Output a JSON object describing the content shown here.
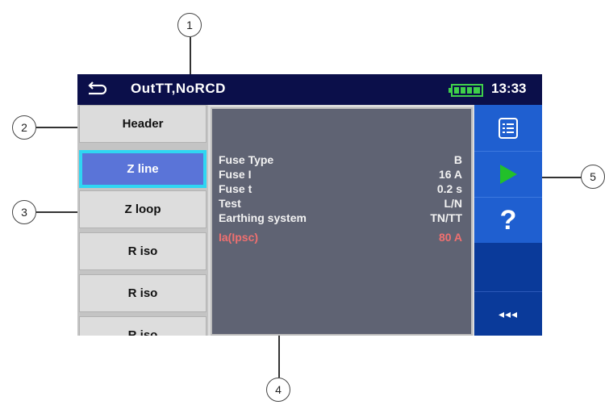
{
  "titlebar": {
    "title": "OutTT,NoRCD",
    "time": "13:33",
    "back_icon": "back-arrow-icon",
    "battery_icon": "battery-icon"
  },
  "list": {
    "items": [
      {
        "label": "Header"
      },
      {
        "label": "Z line",
        "selected": true
      },
      {
        "label": "Z loop"
      },
      {
        "label": "R iso"
      },
      {
        "label": "R iso"
      },
      {
        "label": "R iso"
      }
    ]
  },
  "parameters": [
    {
      "label": "Fuse Type",
      "value": "B"
    },
    {
      "label": "Fuse I",
      "value": "16 A"
    },
    {
      "label": "Fuse t",
      "value": "0.2 s"
    },
    {
      "label": "Test",
      "value": "L/N"
    },
    {
      "label": "Earthing system",
      "value": "TN/TT"
    }
  ],
  "result": {
    "label": "Ia(Ipsc)",
    "value": "80 A"
  },
  "toolbar": {
    "options_icon": "list-options-icon",
    "start_icon": "play-icon",
    "help_label": "?",
    "more_label": "◂◂◂"
  },
  "callouts": [
    "1",
    "2",
    "3",
    "4",
    "5"
  ],
  "colors": {
    "titlebar": "#0b0f4a",
    "selected": "#5a74d8",
    "selected_border": "#2fd6f2",
    "panel": "#5f6373",
    "toolbar": "#1f5fd0",
    "start_green": "#22c02a",
    "result_text": "#f07070"
  }
}
